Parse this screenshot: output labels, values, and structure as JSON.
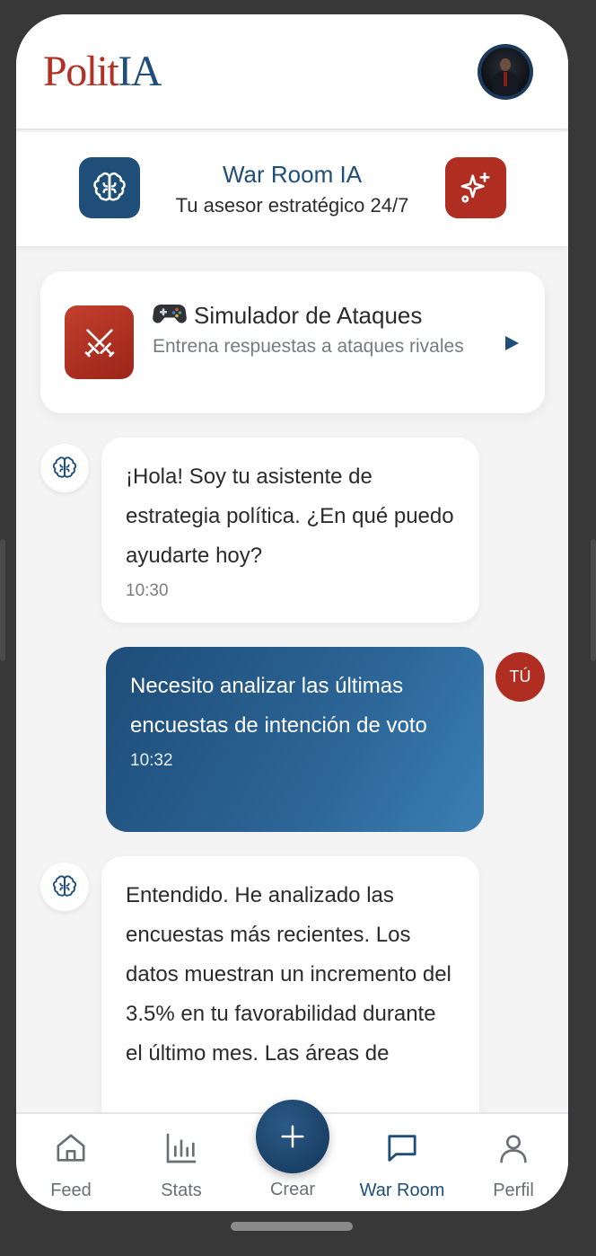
{
  "header": {
    "logo_part1": "Polit",
    "logo_part2": "IA",
    "logo_color1": "#b23124",
    "logo_color2": "#1f4e7a"
  },
  "war_room": {
    "title": "War Room IA",
    "subtitle": "Tu asesor estratégico 24/7",
    "left_icon": "brain-icon",
    "right_icon": "sparkles-icon"
  },
  "simulator": {
    "icon": "crossed-swords-icon",
    "emoji": "gamepad-icon",
    "title": "Simulador de Ataques",
    "subtitle": "Entrena respuestas a ataques rivales",
    "action_icon": "play-icon"
  },
  "messages": [
    {
      "sender": "bot",
      "text": "¡Hola! Soy tu asistente de estrategia política. ¿En qué puedo ayudarte hoy?",
      "time": "10:30"
    },
    {
      "sender": "user",
      "avatar_label": "TÚ",
      "text": "Necesito analizar las últimas encuestas de intención de voto",
      "time": "10:32"
    },
    {
      "sender": "bot",
      "text": "Entendido. He analizado las encuestas más recientes. Los datos muestran un incremento del 3.5% en tu favorabilidad durante el último mes. Las áreas de"
    }
  ],
  "tabbar": {
    "items": [
      {
        "label": "Feed",
        "icon": "home-icon"
      },
      {
        "label": "Stats",
        "icon": "bar-chart-icon"
      },
      {
        "label": "Crear",
        "icon": "plus-icon"
      },
      {
        "label": "War Room",
        "icon": "chat-icon",
        "active": true
      },
      {
        "label": "Perfil",
        "icon": "user-icon"
      }
    ]
  },
  "colors": {
    "primary": "#1f4e79",
    "accent": "#b02d21",
    "background": "#f4f4f5"
  }
}
